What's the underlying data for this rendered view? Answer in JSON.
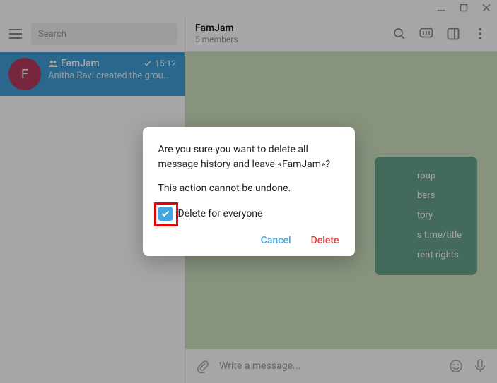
{
  "titlebar": {},
  "left": {
    "search_placeholder": "Search",
    "chat": {
      "avatar_letter": "F",
      "name": "FamJam",
      "time": "15:12",
      "preview": "Anitha Ravi created the grou…"
    }
  },
  "header": {
    "title": "FamJam",
    "subtitle": "5 members"
  },
  "manage_panel": {
    "items": [
      "roup",
      "",
      "bers",
      "tory",
      "s t.me/title",
      "rent rights"
    ]
  },
  "composer": {
    "placeholder": "Write a message..."
  },
  "dialog": {
    "text": "Are you sure you want to delete all message history and leave «FamJam»?",
    "warn": "This action cannot be undone.",
    "checkbox_label": "Delete for everyone",
    "cancel": "Cancel",
    "delete": "Delete"
  }
}
